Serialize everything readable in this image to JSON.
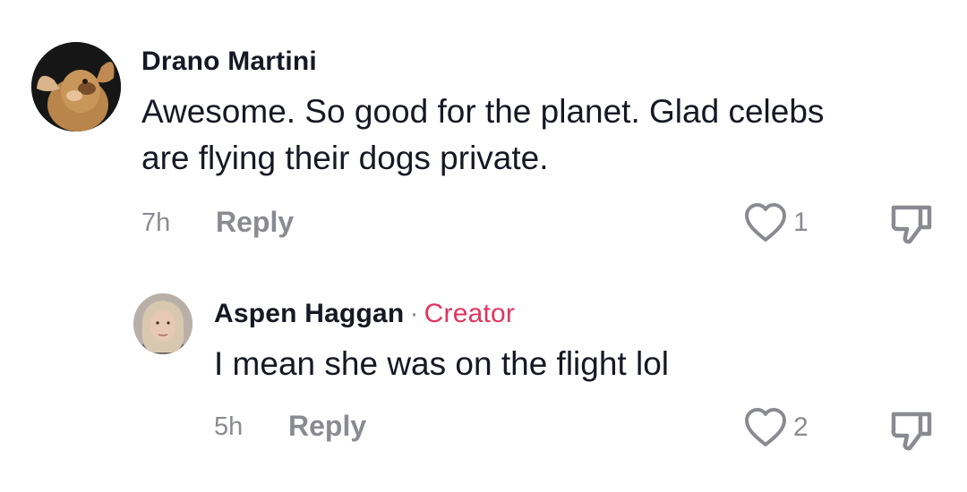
{
  "comments": [
    {
      "username": "Drano Martini",
      "text": "Awesome. So good for the planet. Glad celebs are flying their dogs private.",
      "time": "7h",
      "reply_label": "Reply",
      "likes": "1"
    },
    {
      "username": "Aspen Haggan",
      "separator": "·",
      "badge": "Creator",
      "text": "I mean she was on the flight lol",
      "time": "5h",
      "reply_label": "Reply",
      "likes": "2"
    }
  ],
  "icons": {
    "like": "heart-outline-icon",
    "dislike": "thumbs-down-icon"
  },
  "colors": {
    "creator_badge": "#e0355f",
    "muted": "#8a8b91",
    "text": "#161823"
  }
}
